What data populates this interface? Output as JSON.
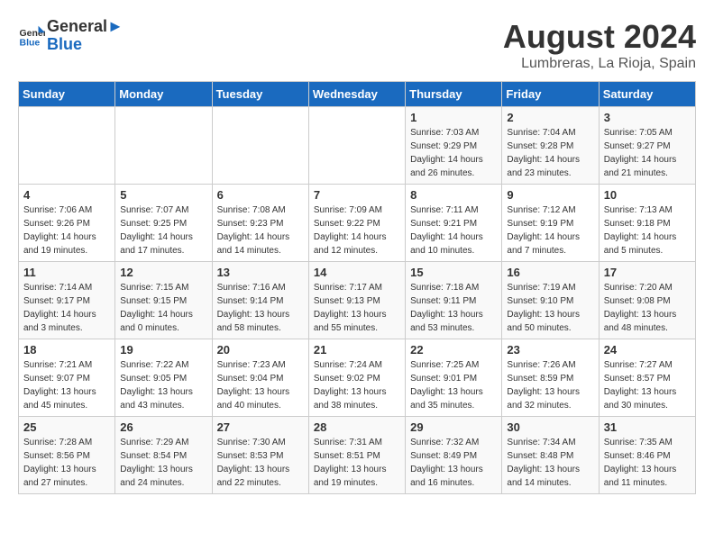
{
  "header": {
    "logo_line1": "General",
    "logo_line2": "Blue",
    "month_year": "August 2024",
    "location": "Lumbreras, La Rioja, Spain"
  },
  "weekdays": [
    "Sunday",
    "Monday",
    "Tuesday",
    "Wednesday",
    "Thursday",
    "Friday",
    "Saturday"
  ],
  "weeks": [
    [
      {
        "day": "",
        "info": ""
      },
      {
        "day": "",
        "info": ""
      },
      {
        "day": "",
        "info": ""
      },
      {
        "day": "",
        "info": ""
      },
      {
        "day": "1",
        "info": "Sunrise: 7:03 AM\nSunset: 9:29 PM\nDaylight: 14 hours\nand 26 minutes."
      },
      {
        "day": "2",
        "info": "Sunrise: 7:04 AM\nSunset: 9:28 PM\nDaylight: 14 hours\nand 23 minutes."
      },
      {
        "day": "3",
        "info": "Sunrise: 7:05 AM\nSunset: 9:27 PM\nDaylight: 14 hours\nand 21 minutes."
      }
    ],
    [
      {
        "day": "4",
        "info": "Sunrise: 7:06 AM\nSunset: 9:26 PM\nDaylight: 14 hours\nand 19 minutes."
      },
      {
        "day": "5",
        "info": "Sunrise: 7:07 AM\nSunset: 9:25 PM\nDaylight: 14 hours\nand 17 minutes."
      },
      {
        "day": "6",
        "info": "Sunrise: 7:08 AM\nSunset: 9:23 PM\nDaylight: 14 hours\nand 14 minutes."
      },
      {
        "day": "7",
        "info": "Sunrise: 7:09 AM\nSunset: 9:22 PM\nDaylight: 14 hours\nand 12 minutes."
      },
      {
        "day": "8",
        "info": "Sunrise: 7:11 AM\nSunset: 9:21 PM\nDaylight: 14 hours\nand 10 minutes."
      },
      {
        "day": "9",
        "info": "Sunrise: 7:12 AM\nSunset: 9:19 PM\nDaylight: 14 hours\nand 7 minutes."
      },
      {
        "day": "10",
        "info": "Sunrise: 7:13 AM\nSunset: 9:18 PM\nDaylight: 14 hours\nand 5 minutes."
      }
    ],
    [
      {
        "day": "11",
        "info": "Sunrise: 7:14 AM\nSunset: 9:17 PM\nDaylight: 14 hours\nand 3 minutes."
      },
      {
        "day": "12",
        "info": "Sunrise: 7:15 AM\nSunset: 9:15 PM\nDaylight: 14 hours\nand 0 minutes."
      },
      {
        "day": "13",
        "info": "Sunrise: 7:16 AM\nSunset: 9:14 PM\nDaylight: 13 hours\nand 58 minutes."
      },
      {
        "day": "14",
        "info": "Sunrise: 7:17 AM\nSunset: 9:13 PM\nDaylight: 13 hours\nand 55 minutes."
      },
      {
        "day": "15",
        "info": "Sunrise: 7:18 AM\nSunset: 9:11 PM\nDaylight: 13 hours\nand 53 minutes."
      },
      {
        "day": "16",
        "info": "Sunrise: 7:19 AM\nSunset: 9:10 PM\nDaylight: 13 hours\nand 50 minutes."
      },
      {
        "day": "17",
        "info": "Sunrise: 7:20 AM\nSunset: 9:08 PM\nDaylight: 13 hours\nand 48 minutes."
      }
    ],
    [
      {
        "day": "18",
        "info": "Sunrise: 7:21 AM\nSunset: 9:07 PM\nDaylight: 13 hours\nand 45 minutes."
      },
      {
        "day": "19",
        "info": "Sunrise: 7:22 AM\nSunset: 9:05 PM\nDaylight: 13 hours\nand 43 minutes."
      },
      {
        "day": "20",
        "info": "Sunrise: 7:23 AM\nSunset: 9:04 PM\nDaylight: 13 hours\nand 40 minutes."
      },
      {
        "day": "21",
        "info": "Sunrise: 7:24 AM\nSunset: 9:02 PM\nDaylight: 13 hours\nand 38 minutes."
      },
      {
        "day": "22",
        "info": "Sunrise: 7:25 AM\nSunset: 9:01 PM\nDaylight: 13 hours\nand 35 minutes."
      },
      {
        "day": "23",
        "info": "Sunrise: 7:26 AM\nSunset: 8:59 PM\nDaylight: 13 hours\nand 32 minutes."
      },
      {
        "day": "24",
        "info": "Sunrise: 7:27 AM\nSunset: 8:57 PM\nDaylight: 13 hours\nand 30 minutes."
      }
    ],
    [
      {
        "day": "25",
        "info": "Sunrise: 7:28 AM\nSunset: 8:56 PM\nDaylight: 13 hours\nand 27 minutes."
      },
      {
        "day": "26",
        "info": "Sunrise: 7:29 AM\nSunset: 8:54 PM\nDaylight: 13 hours\nand 24 minutes."
      },
      {
        "day": "27",
        "info": "Sunrise: 7:30 AM\nSunset: 8:53 PM\nDaylight: 13 hours\nand 22 minutes."
      },
      {
        "day": "28",
        "info": "Sunrise: 7:31 AM\nSunset: 8:51 PM\nDaylight: 13 hours\nand 19 minutes."
      },
      {
        "day": "29",
        "info": "Sunrise: 7:32 AM\nSunset: 8:49 PM\nDaylight: 13 hours\nand 16 minutes."
      },
      {
        "day": "30",
        "info": "Sunrise: 7:34 AM\nSunset: 8:48 PM\nDaylight: 13 hours\nand 14 minutes."
      },
      {
        "day": "31",
        "info": "Sunrise: 7:35 AM\nSunset: 8:46 PM\nDaylight: 13 hours\nand 11 minutes."
      }
    ]
  ]
}
